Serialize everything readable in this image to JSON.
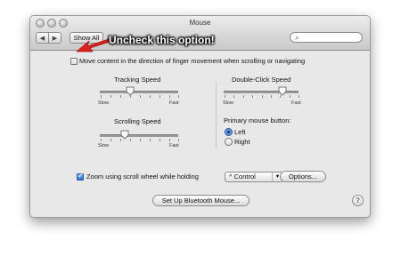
{
  "window": {
    "title": "Mouse"
  },
  "toolbar": {
    "back": "◀",
    "forward": "▶",
    "show_all": "Show All",
    "search_icon": "search-icon",
    "search_placeholder": ""
  },
  "annotation": {
    "text": "Uncheck this option!",
    "arrow_color": "#e0201b"
  },
  "scroll_direction": {
    "label": "Move content in the direction of finger movement when scrolling or navigating",
    "checked": false
  },
  "tracking": {
    "title": "Tracking Speed",
    "slow": "Slow",
    "fast": "Fast",
    "level": 0.4
  },
  "double_click": {
    "title": "Double-Click Speed",
    "slow": "Slow",
    "fast": "Fast",
    "level": 0.72
  },
  "scrolling": {
    "title": "Scrolling Speed",
    "slow": "Slow",
    "fast": "Fast",
    "level": 0.33
  },
  "primary_button": {
    "title": "Primary mouse button:",
    "options": [
      "Left",
      "Right"
    ],
    "selected": "Left"
  },
  "zoom": {
    "label": "Zoom using scroll wheel while holding",
    "checked": true,
    "modifier": "^ Control",
    "options_button": "Options..."
  },
  "bluetooth_button": "Set Up Bluetooth Mouse...",
  "help_button": "?",
  "colors": {
    "selection_blue": "#2f6fcf"
  }
}
